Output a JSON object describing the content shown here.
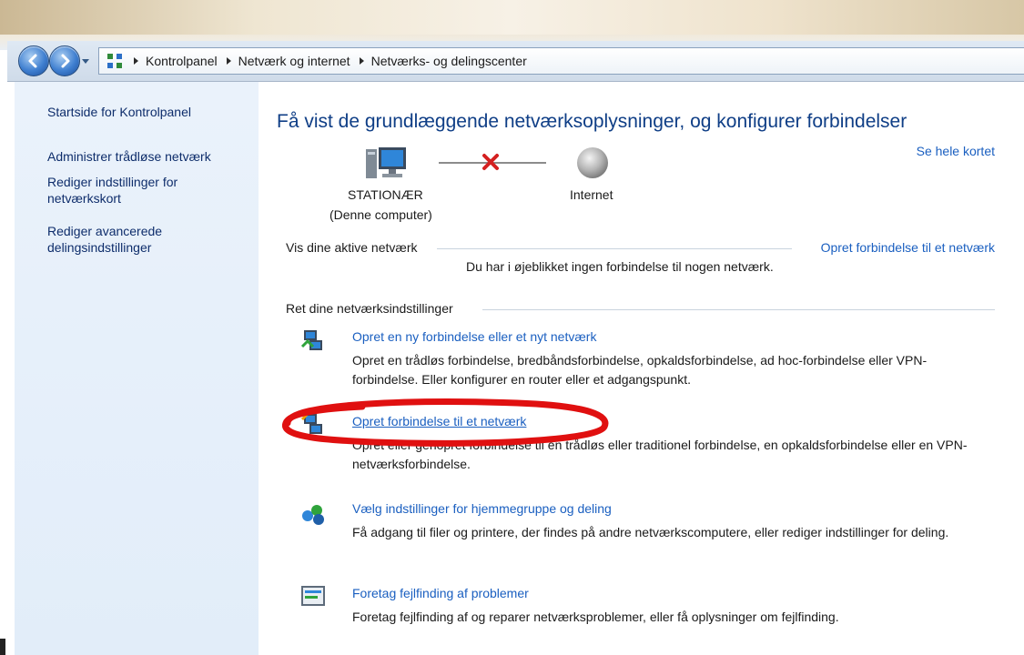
{
  "breadcrumb": [
    "Kontrolpanel",
    "Netværk og internet",
    "Netværks- og delingscenter"
  ],
  "sidebar": {
    "items": [
      {
        "label": "Startside for Kontrolpanel"
      },
      {
        "label": "Administrer trådløse netværk"
      },
      {
        "label": "Rediger indstillinger for netværkskort"
      },
      {
        "label": "Rediger avancerede delingsindstillinger"
      }
    ]
  },
  "main": {
    "title": "Få vist de grundlæggende netværksoplysninger, og konfigurer forbindelser",
    "see_full_map": "Se hele kortet",
    "computer_name": "STATIONÆR",
    "computer_sub": "(Denne computer)",
    "internet_label": "Internet",
    "active_networks_label": "Vis dine aktive netværk",
    "create_connection_link": "Opret forbindelse til et netværk",
    "no_connection_text": "Du har i øjeblikket ingen forbindelse til nogen netværk.",
    "change_settings_label": "Ret dine netværksindstillinger",
    "tasks": [
      {
        "title": "Opret en ny forbindelse eller et nyt netværk",
        "description": "Opret en trådløs forbindelse, bredbåndsforbindelse, opkaldsforbindelse, ad hoc-forbindelse eller VPN-forbindelse. Eller konfigurer en router eller et adgangspunkt.",
        "icon": "network-setup-icon"
      },
      {
        "title": "Opret forbindelse til et netværk",
        "description": "Opret eller genopret forbindelse til en trådløs eller traditionel forbindelse, en opkaldsforbindelse eller en VPN-netværksforbindelse.",
        "icon": "network-connect-icon"
      },
      {
        "title": "Vælg indstillinger for hjemmegruppe og deling",
        "description": "Få adgang til filer og printere, der findes på andre netværkscomputere, eller rediger indstillinger for deling.",
        "icon": "homegroup-icon"
      },
      {
        "title": "Foretag fejlfinding af problemer",
        "description": "Foretag fejlfinding af og reparer netværksproblemer, eller få oplysninger om fejlfinding.",
        "icon": "troubleshoot-icon"
      }
    ]
  },
  "colors": {
    "link": "#1a5fc0",
    "title": "#0f3e86",
    "sidebar_bg": "#e2edf9",
    "highlight_ring": "#e01010",
    "disconnected_x": "#d42020"
  }
}
